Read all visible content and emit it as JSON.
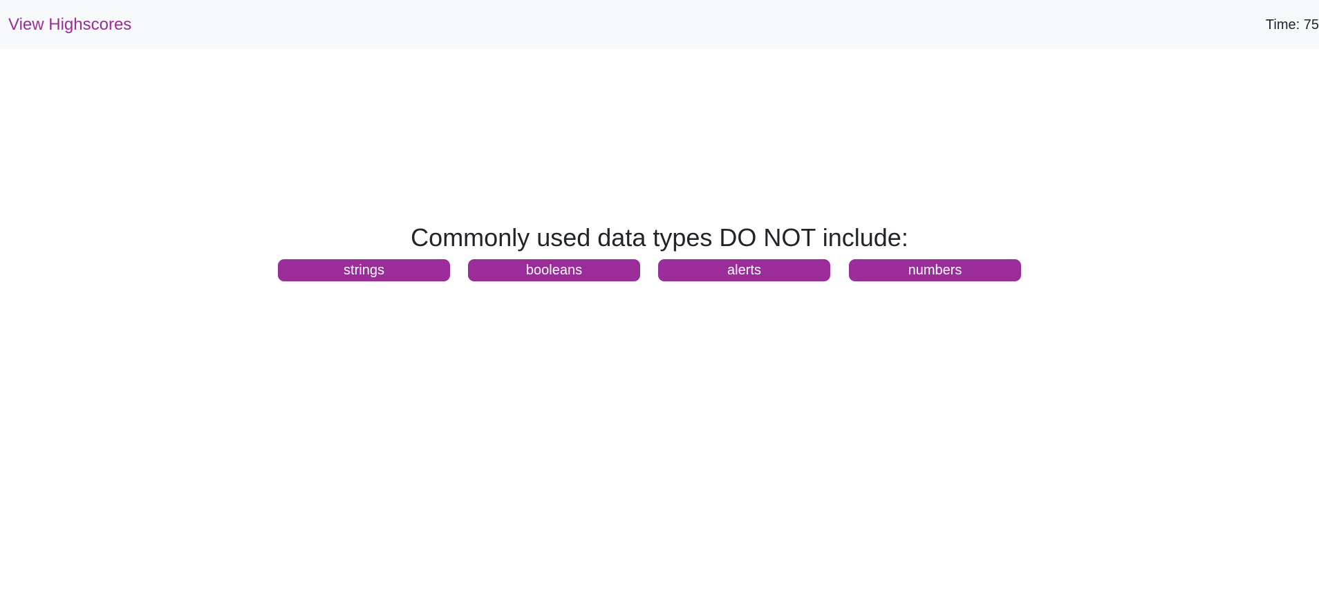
{
  "header": {
    "highscores_link": "View Highscores",
    "timer_label": "Time: ",
    "timer_value": "75"
  },
  "quiz": {
    "question": "Commonly used data types DO NOT include:",
    "answers": [
      {
        "label": "strings"
      },
      {
        "label": "booleans"
      },
      {
        "label": "alerts"
      },
      {
        "label": "numbers"
      }
    ]
  },
  "colors": {
    "accent": "#9b2d9b",
    "navbar_bg": "#f8f9fa",
    "text": "#212529"
  }
}
